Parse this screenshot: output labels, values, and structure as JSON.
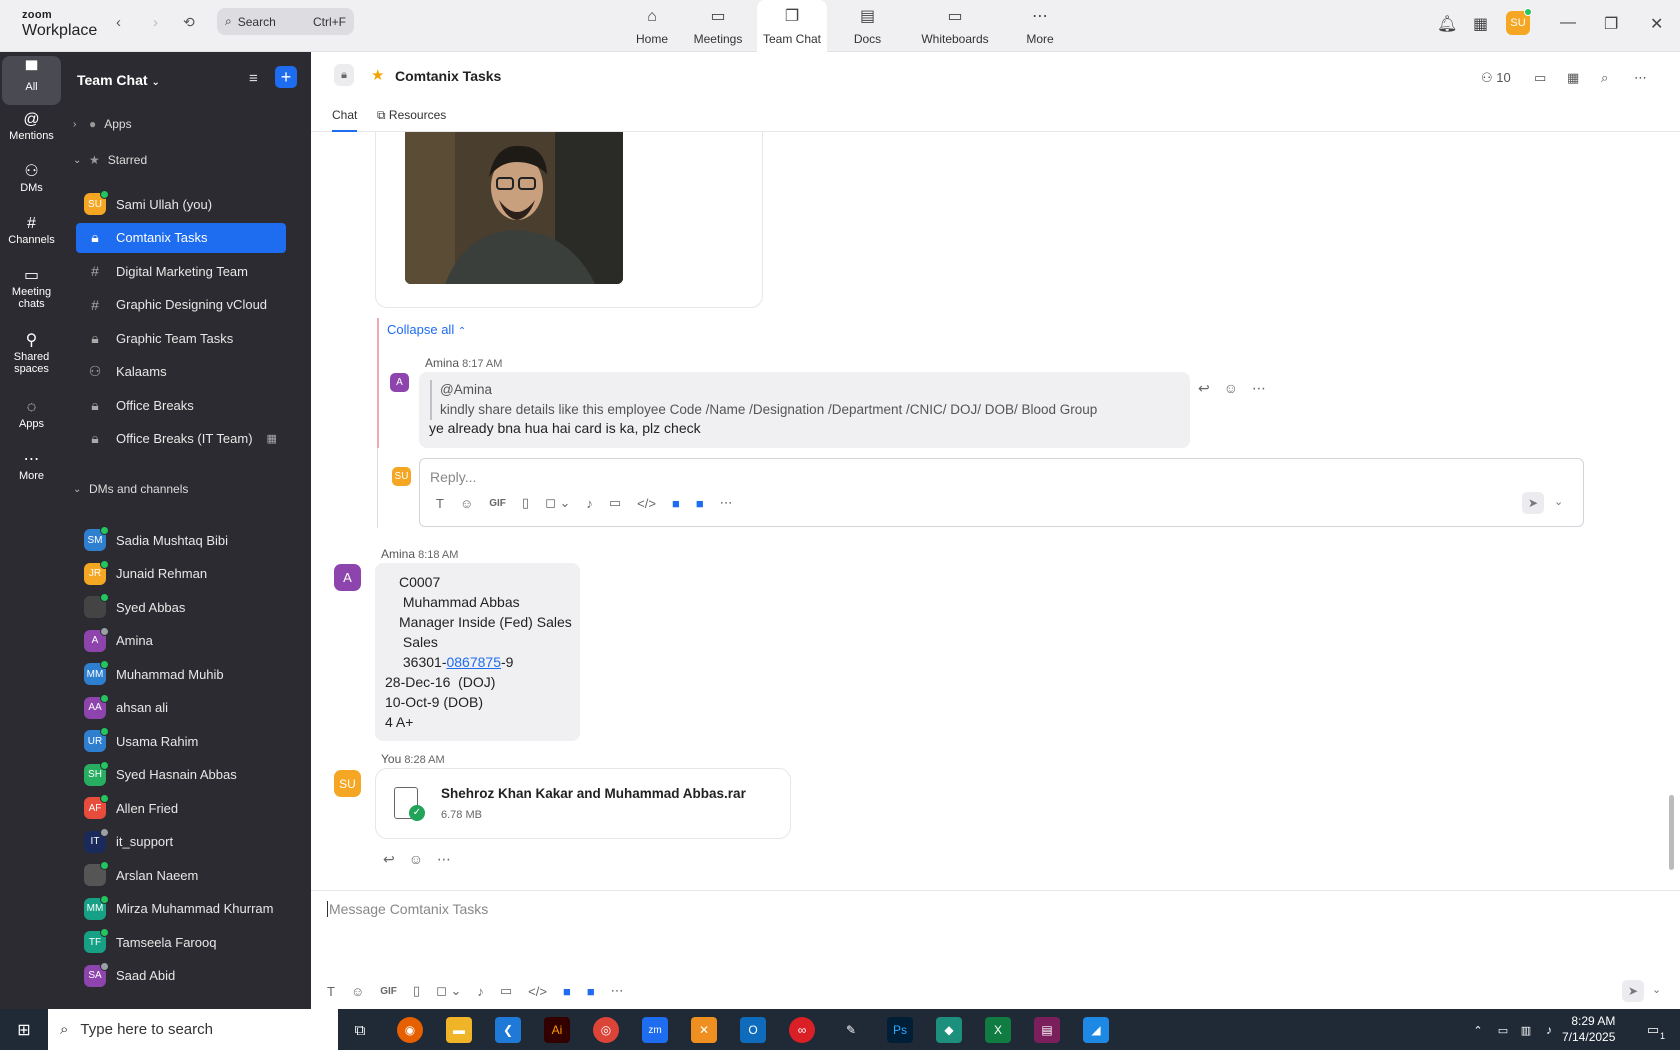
{
  "topbar": {
    "brand_line1": "zoom",
    "brand_line2": "Workplace",
    "search_placeholder": "Search",
    "search_shortcut": "Ctrl+F",
    "tabs": [
      {
        "label": "Home",
        "icon": "home-icon"
      },
      {
        "label": "Meetings",
        "icon": "video-icon"
      },
      {
        "label": "Team Chat",
        "icon": "chat-icon"
      },
      {
        "label": "Docs",
        "icon": "document-icon"
      },
      {
        "label": "Whiteboards",
        "icon": "whiteboard-icon"
      },
      {
        "label": "More",
        "icon": "more-icon"
      }
    ],
    "active_tab": "Team Chat",
    "user_initials": "SU"
  },
  "rail": [
    {
      "label": "All",
      "icon": "chat-bubble-icon",
      "active": true
    },
    {
      "label": "Mentions",
      "icon": "at-icon"
    },
    {
      "label": "DMs",
      "icon": "people-icon"
    },
    {
      "label": "Channels",
      "icon": "hash-icon"
    },
    {
      "label": "Meeting chats",
      "icon": "calendar-icon"
    },
    {
      "label": "Shared spaces",
      "icon": "shared-icon"
    },
    {
      "label": "Apps",
      "icon": "apps-icon"
    },
    {
      "label": "More",
      "icon": "more-icon"
    }
  ],
  "sidebar": {
    "title": "Team Chat",
    "sections": {
      "apps": "Apps",
      "starred": "Starred",
      "dms": "DMs and channels"
    },
    "starred": [
      {
        "label": "Sami Ullah (you)",
        "type": "avatar",
        "initials": "SU",
        "color": "#f5a623",
        "status": "online"
      },
      {
        "label": "Comtanix Tasks",
        "type": "lock",
        "active": true
      },
      {
        "label": "Digital Marketing Team",
        "type": "hash"
      },
      {
        "label": "Graphic Designing vCloud",
        "type": "hash"
      },
      {
        "label": "Graphic Team Tasks",
        "type": "lock"
      },
      {
        "label": "Kalaams",
        "type": "group"
      },
      {
        "label": "Office Breaks",
        "type": "lock"
      },
      {
        "label": "Office Breaks (IT Team)",
        "type": "lock"
      }
    ],
    "dms": [
      {
        "label": "Sadia Mushtaq Bibi",
        "initials": "SM",
        "color": "#2f7fd1",
        "status": "online"
      },
      {
        "label": "Junaid Rehman",
        "initials": "JR",
        "color": "#f5a623",
        "status": "online"
      },
      {
        "label": "Syed Abbas",
        "initials": "",
        "color": "#444",
        "status": "online"
      },
      {
        "label": "Amina",
        "initials": "A",
        "color": "#8e44ad",
        "status": "away"
      },
      {
        "label": "Muhammad Muhib",
        "initials": "MM",
        "color": "#2f7fd1",
        "status": "online"
      },
      {
        "label": "ahsan ali",
        "initials": "AA",
        "color": "#8e44ad",
        "status": "online"
      },
      {
        "label": "Usama Rahim",
        "initials": "UR",
        "color": "#2f7fd1",
        "status": "online"
      },
      {
        "label": "Syed Hasnain Abbas",
        "initials": "SH",
        "color": "#27ae60",
        "status": "online"
      },
      {
        "label": "Allen Fried",
        "initials": "AF",
        "color": "#e74c3c",
        "status": "online"
      },
      {
        "label": "it_support",
        "initials": "IT",
        "color": "#1a2a5a",
        "status": "away"
      },
      {
        "label": "Arslan Naeem",
        "initials": "",
        "color": "#555",
        "status": "online"
      },
      {
        "label": "Mirza Muhammad Khurram",
        "initials": "MM",
        "color": "#16a085",
        "status": "online"
      },
      {
        "label": "Tamseela Farooq",
        "initials": "TF",
        "color": "#16a085",
        "status": "online"
      },
      {
        "label": "Saad Abid",
        "initials": "SA",
        "color": "#8e44ad",
        "status": "away"
      }
    ]
  },
  "chat": {
    "title": "Comtanix Tasks",
    "member_count": "10",
    "tabs": [
      "Chat",
      "Resources"
    ],
    "collapse_label": "Collapse all",
    "thread_reply": {
      "author": "Amina",
      "time": "8:17 AM",
      "initial": "A",
      "quote_mention": "@Amina",
      "quote_text": "kindly share details like this  employee Code /Name /Designation /Department /CNIC/ DOJ/ DOB/ Blood Group",
      "text": "ye already bna hua hai card is ka, plz check"
    },
    "reply_placeholder": "Reply...",
    "reply_avatar": "SU",
    "message2": {
      "author": "Amina",
      "time": "8:18 AM",
      "initial": "A",
      "lines": [
        "C0007",
        " Muhammad Abbas",
        "Manager Inside (Fed) Sales",
        " Sales"
      ],
      "cnic_prefix": " 36301-",
      "cnic_link": "0867875",
      "cnic_suffix": "-9",
      "lines2": [
        "28-Dec-16  (DOJ)",
        "10-Oct-9 (DOB)",
        "4 A+"
      ]
    },
    "message3": {
      "author": "You",
      "time": "8:28 AM",
      "initials": "SU",
      "file_name": "Shehroz Khan Kakar and Muhammad Abbas.rar",
      "file_size": "6.78 MB"
    },
    "composer_placeholder": "Message Comtanix Tasks"
  },
  "taskbar": {
    "search_placeholder": "Type here to search",
    "time": "8:29 AM",
    "date": "7/14/2025",
    "notification_count": "1"
  }
}
